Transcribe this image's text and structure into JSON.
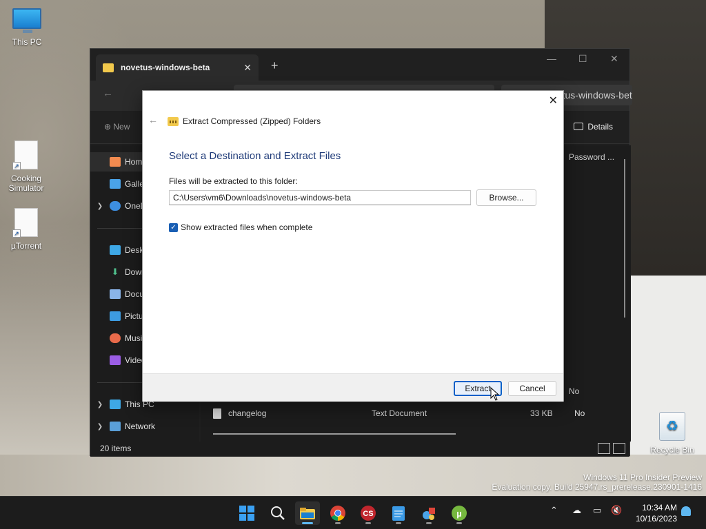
{
  "desktop": {
    "icons": [
      {
        "label": "This PC",
        "icon": "monitor-icon"
      },
      {
        "label": "Cooking Simulator",
        "icon": "shortcut-file-icon"
      },
      {
        "label": "µTorrent",
        "icon": "shortcut-file-icon"
      },
      {
        "label": "Recycle Bin",
        "icon": "recycle-bin-icon"
      }
    ],
    "watermark": {
      "line1": "Windows 11 Pro Insider Preview",
      "line2": "Evaluation copy. Build 25947.rs_prerelease.230901-1416"
    }
  },
  "explorer": {
    "tab_title": "novetus-windows-beta",
    "search_placeholder": "Search novetus-windows-beta",
    "new_label": "New",
    "details_label": "Details",
    "column_header": "Password ...",
    "nav": [
      {
        "label": "Home"
      },
      {
        "label": "Gallery"
      },
      {
        "label": "OneDrive"
      },
      {
        "label": "Desktop"
      },
      {
        "label": "Downloads"
      },
      {
        "label": "Documents"
      },
      {
        "label": "Pictures"
      },
      {
        "label": "Music"
      },
      {
        "label": "Videos"
      },
      {
        "label": "This PC"
      },
      {
        "label": "Network"
      }
    ],
    "files": [
      {
        "name": "changelog",
        "type": "Text Document",
        "size": "33 KB",
        "password": "No"
      }
    ],
    "row_partial_password": "No",
    "status": "20 items"
  },
  "dialog": {
    "header": "Extract Compressed (Zipped) Folders",
    "title": "Select a Destination and Extract Files",
    "label": "Files will be extracted to this folder:",
    "path": "C:\\Users\\vm6\\Downloads\\novetus-windows-beta",
    "browse": "Browse...",
    "checkbox_label": "Show extracted files when complete",
    "checkbox_checked": true,
    "extract": "Extract",
    "cancel": "Cancel"
  },
  "taskbar": {
    "apps": [
      "start-icon",
      "search-icon",
      "file-explorer-icon",
      "chrome-icon",
      "cs-app-icon",
      "notepad-icon",
      "app-icon",
      "utorrent-icon"
    ],
    "time": "10:34 AM",
    "date": "10/16/2023"
  },
  "colors": {
    "accent": "#1a5fb4",
    "dialog_title": "#1e3a78",
    "explorer_bg": "#1f1f1f"
  }
}
